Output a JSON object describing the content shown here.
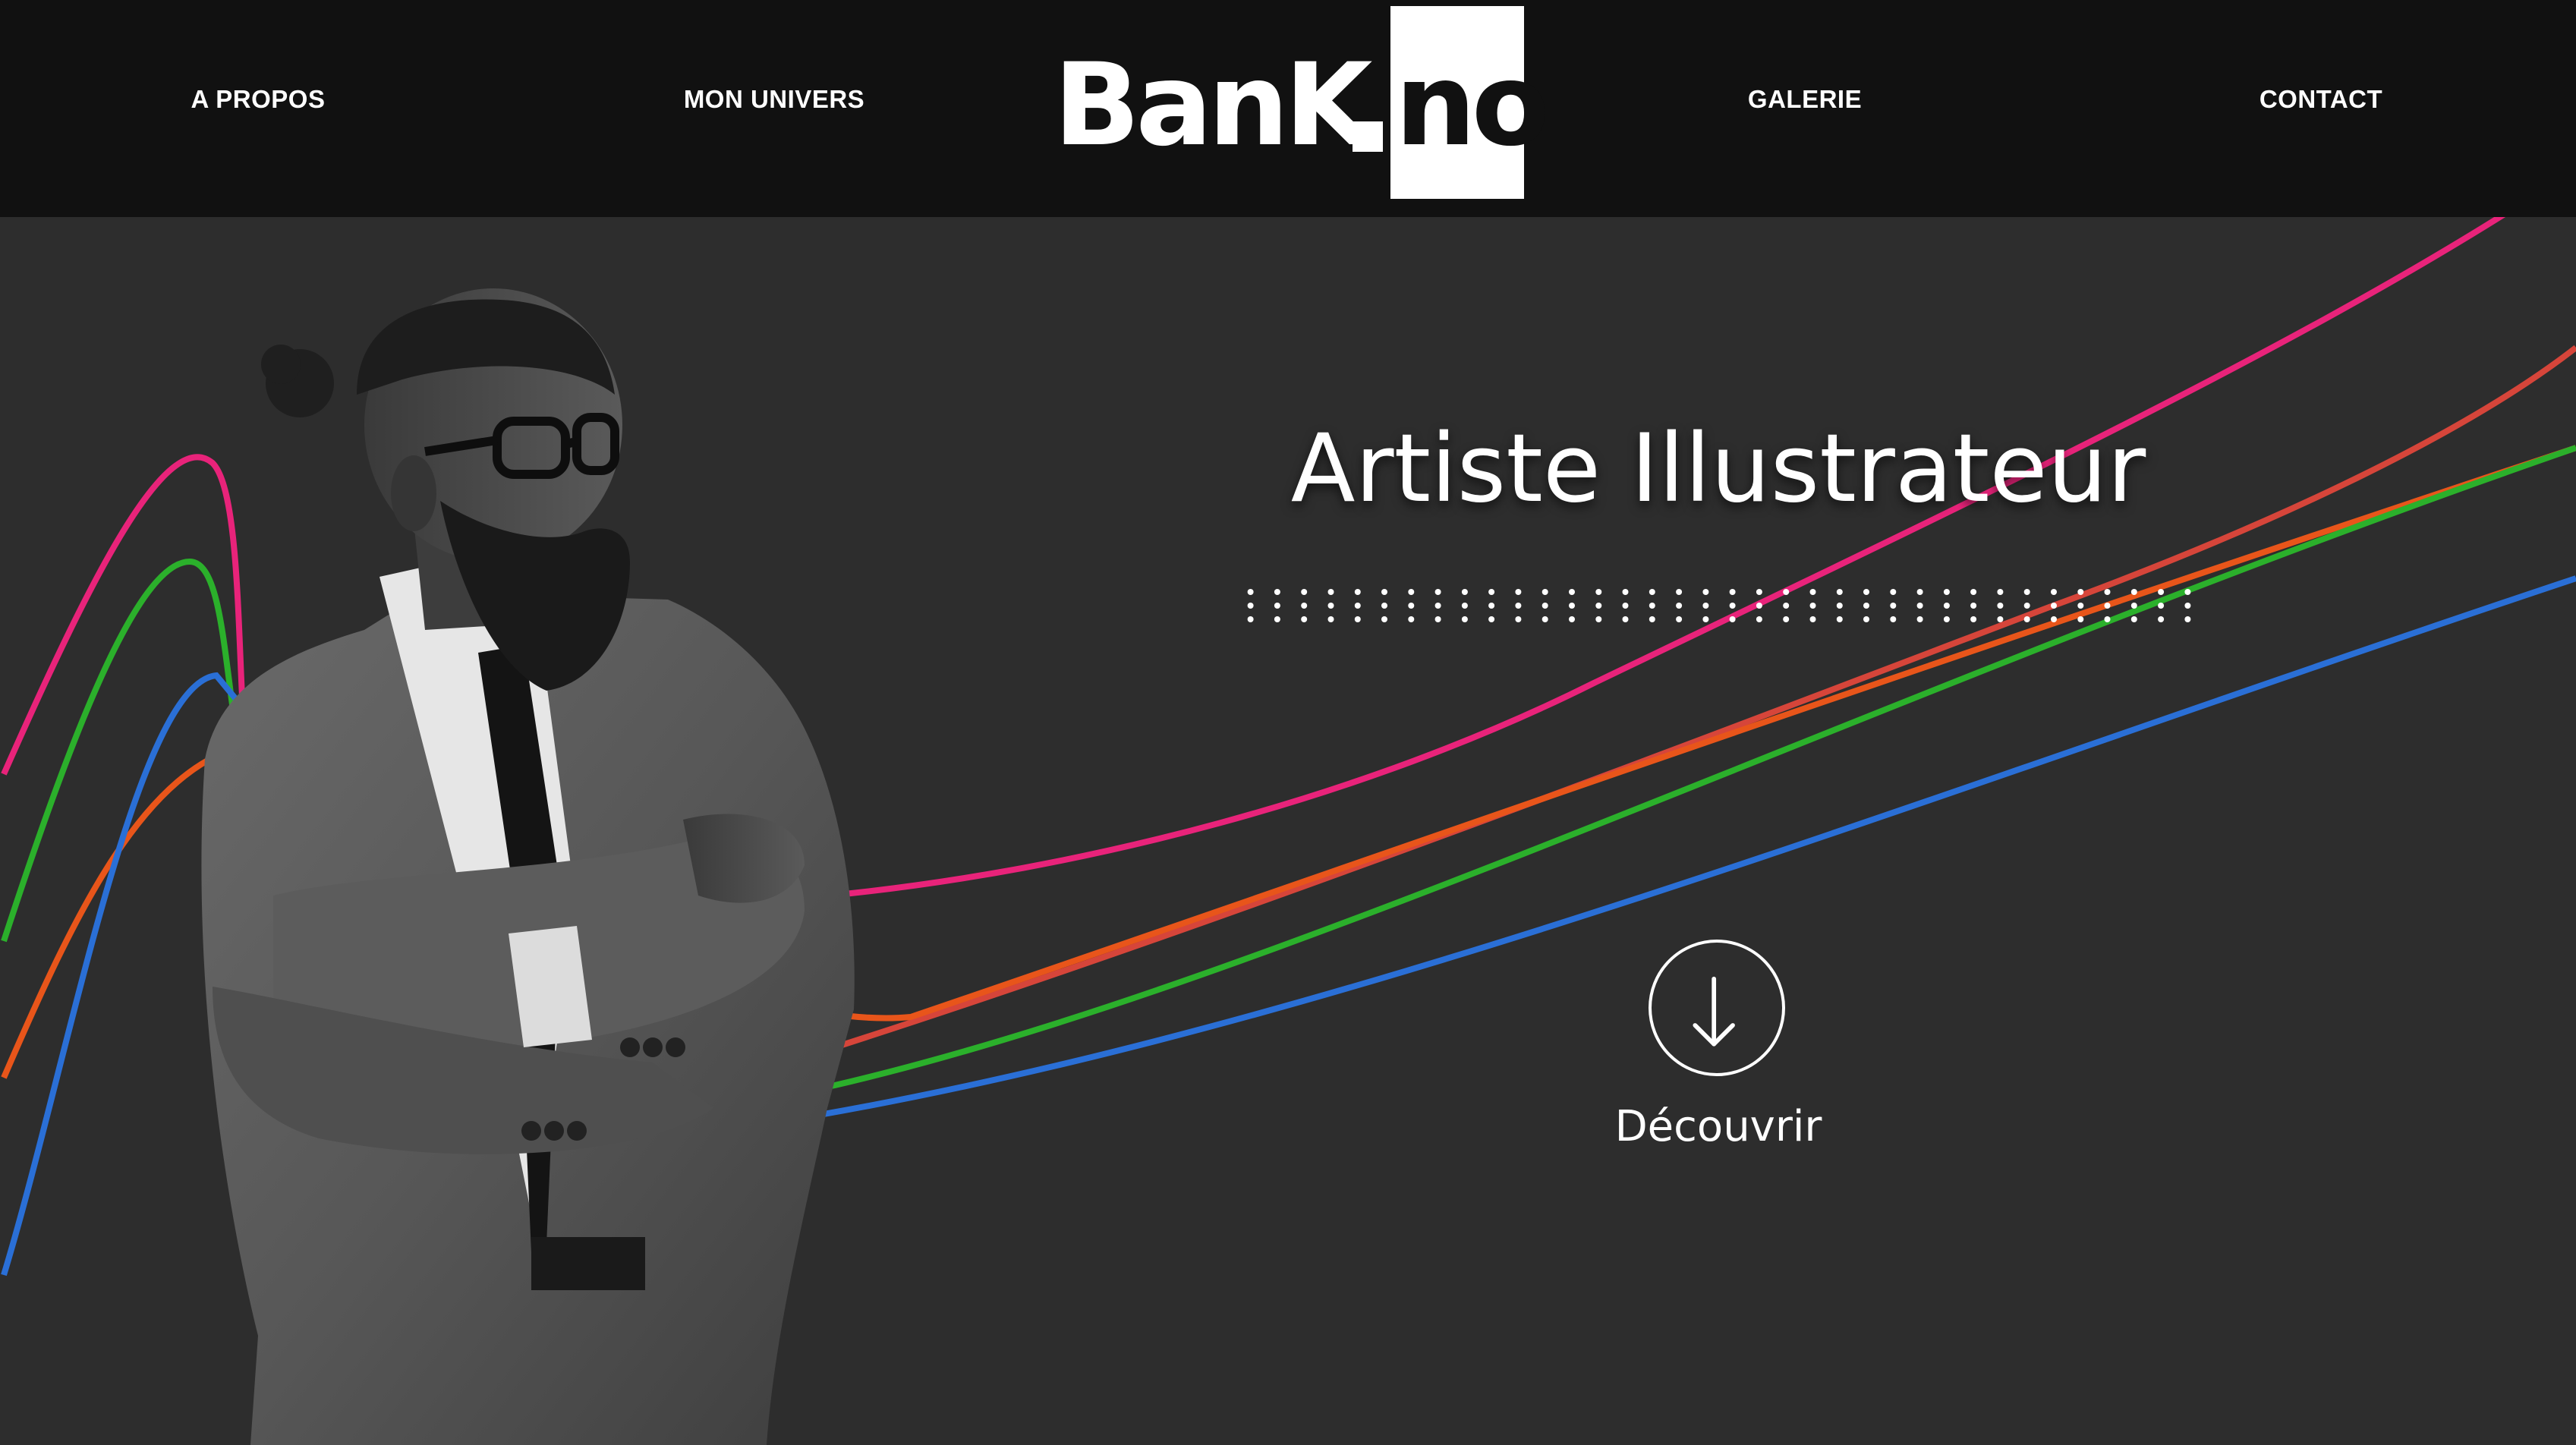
{
  "nav": {
    "a_propos": "A PROPOS",
    "mon_univers": "MON UNIVERS",
    "galerie": "GALERIE",
    "contact": "CONTACT"
  },
  "logo": {
    "text_left": "BanK",
    "text_right": "no"
  },
  "hero": {
    "title": "Artiste Illustrateur",
    "cta_label": "Découvrir",
    "cta_icon": "arrow-down-icon"
  },
  "colors": {
    "header_bg": "#111111",
    "page_bg": "#2d2d2d",
    "text": "#ffffff",
    "line_pink": "#e8237a",
    "line_red": "#d6453a",
    "line_orange": "#e8551a",
    "line_green": "#2bb02b",
    "line_blue": "#2a6fd6"
  }
}
